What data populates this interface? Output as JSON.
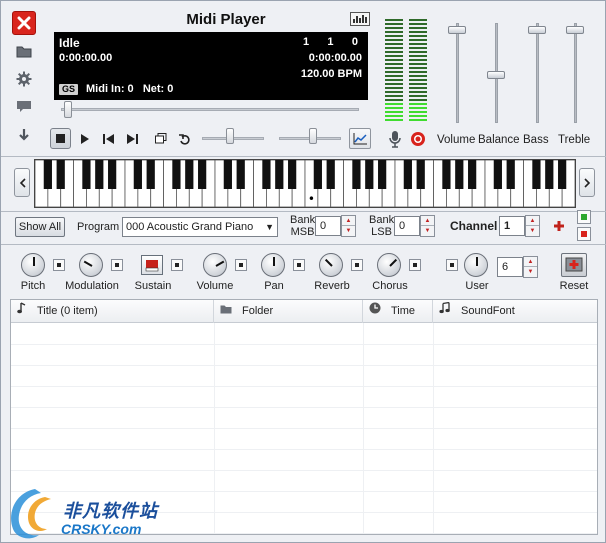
{
  "app": {
    "title": "Midi Player"
  },
  "sidebar": {
    "buttons": [
      {
        "name": "close",
        "icon": "close-icon"
      },
      {
        "name": "open-folder",
        "icon": "folder-icon"
      },
      {
        "name": "settings",
        "icon": "gear-icon"
      },
      {
        "name": "comment",
        "icon": "speech-bubble-icon"
      },
      {
        "name": "download",
        "icon": "arrow-down-icon"
      }
    ]
  },
  "display": {
    "status": "Idle",
    "time_left": "0:00:00.00",
    "position": "1      1      0",
    "time_right": "0:00:00.00",
    "bpm": "120.00 BPM",
    "mode_badge": "GS",
    "midi_info": "Midi In: 0   Net: 0"
  },
  "progress": {
    "value": 0.01
  },
  "mixer": {
    "vu_levels": [
      0.18,
      0.18
    ],
    "faders": [
      {
        "label": "Volume",
        "level": 0.97
      },
      {
        "label": "Balance",
        "level": 0.5
      },
      {
        "label": "Bass",
        "level": 0.97
      },
      {
        "label": "Treble",
        "level": 0.97
      }
    ]
  },
  "transport": {
    "tempo_slider": 0.45,
    "pitch_slider": 0.55
  },
  "piano": {
    "marked_key_label": "•"
  },
  "program": {
    "show_all_label": "Show All",
    "program_label": "Program",
    "program_value": "000 Acoustic Grand Piano",
    "bank_msb_label_1": "Bank",
    "bank_msb_label_2": "MSB",
    "bank_msb_value": "0",
    "bank_lsb_label_1": "Bank",
    "bank_lsb_label_2": "LSB",
    "bank_lsb_value": "0",
    "channel_label": "Channel",
    "channel_value": "1"
  },
  "controls": {
    "knobs": [
      {
        "label": "Pitch",
        "angle": 0
      },
      {
        "label": "Modulation",
        "angle": -60
      },
      {
        "label": "Volume",
        "angle": 60
      },
      {
        "label": "Pan",
        "angle": 0
      },
      {
        "label": "Reverb",
        "angle": -45
      },
      {
        "label": "Chorus",
        "angle": 45
      },
      {
        "label": "User",
        "angle": 0
      }
    ],
    "sustain_label": "Sustain",
    "user_value": "6",
    "reset_label": "Reset"
  },
  "table": {
    "columns": [
      {
        "label": "Title (0 item)",
        "icon": "music-note-icon"
      },
      {
        "label": "Folder",
        "icon": "folder-icon"
      },
      {
        "label": "Time",
        "icon": "clock-icon"
      },
      {
        "label": "SoundFont",
        "icon": "music-note-icon"
      }
    ]
  },
  "watermark": {
    "cn": "非凡软件站",
    "en": "CRSKY.com"
  }
}
